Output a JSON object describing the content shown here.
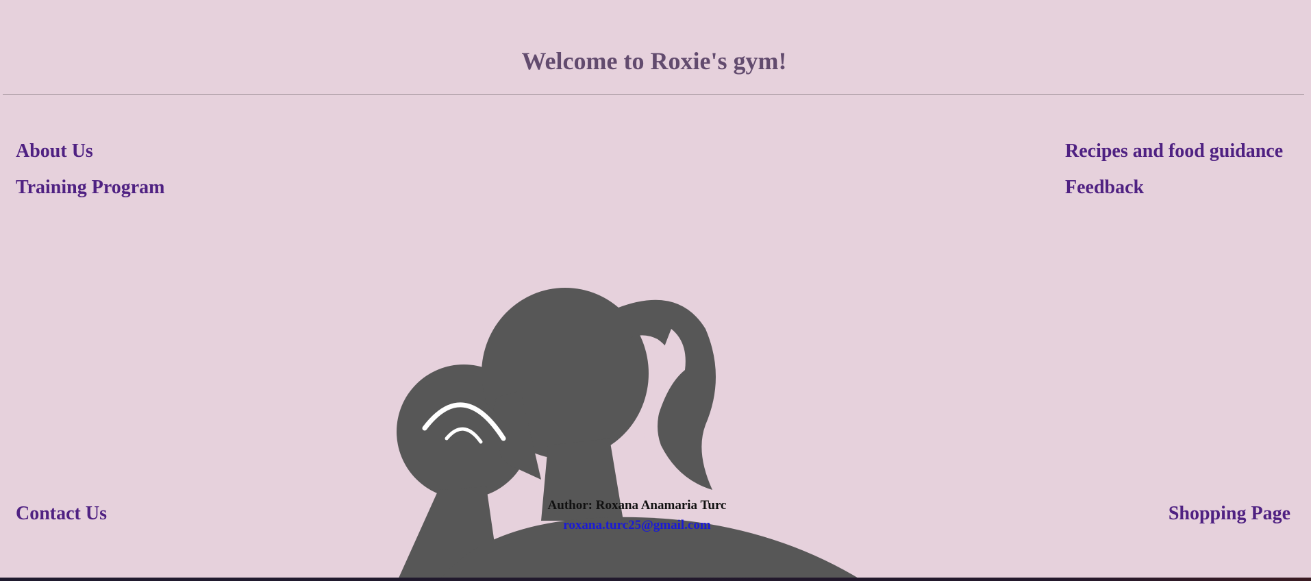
{
  "header": {
    "title": "Welcome to Roxie's gym!"
  },
  "nav": {
    "about": "About Us",
    "training": "Training Program",
    "recipes": "Recipes and food guidance",
    "feedback": "Feedback",
    "contact": "Contact Us",
    "shopping": "Shopping Page"
  },
  "footer": {
    "author": "Author: Roxana Anamaria Turc",
    "email": "roxana.turc25@gmail.com"
  },
  "colors": {
    "background": "#e6d1dc",
    "title": "#624b6e",
    "link": "#4f2182",
    "silhouette": "#575757"
  },
  "hero": {
    "image": "woman-lifting-dumbbell-silhouette"
  }
}
